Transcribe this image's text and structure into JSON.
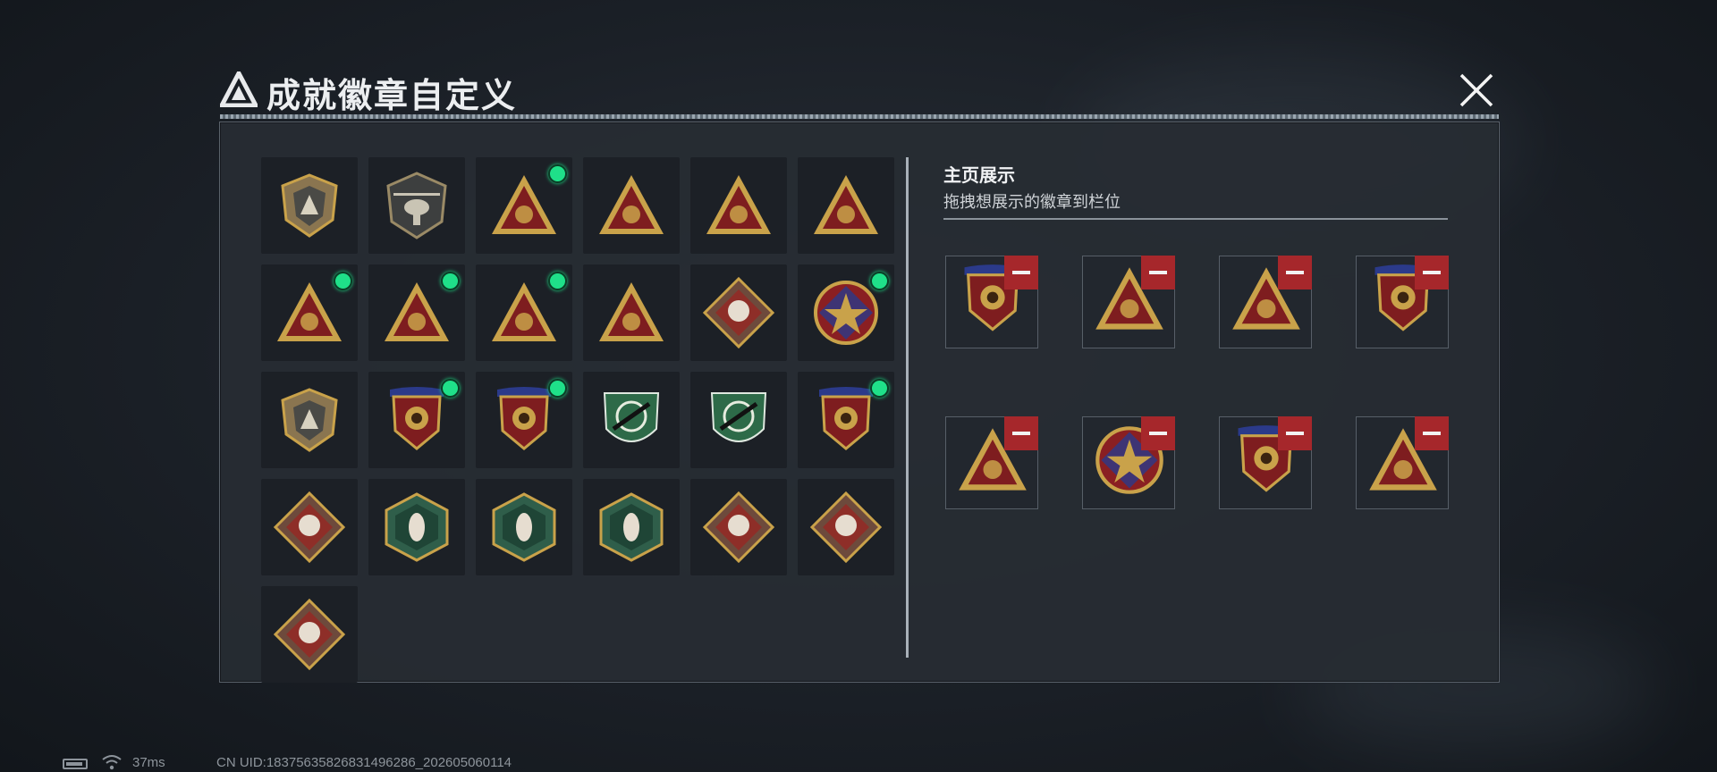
{
  "header": {
    "title": "成就徽章自定义",
    "close_icon": "close-icon"
  },
  "colors": {
    "accent_green": "#1fe089",
    "remove_red": "#a6272b",
    "gold": "#c9a24a",
    "panel": "#272c33"
  },
  "inventory": [
    {
      "id": "gray-shield",
      "type": "shield",
      "new": false
    },
    {
      "id": "helicopter",
      "type": "heli",
      "new": false
    },
    {
      "id": "radar-triangle",
      "type": "tri",
      "new": true
    },
    {
      "id": "s4-triangle",
      "type": "tri",
      "new": false
    },
    {
      "id": "s5-triangle",
      "type": "tri",
      "new": false
    },
    {
      "id": "s5-plane-triangle",
      "type": "tri",
      "new": false
    },
    {
      "id": "rank-1-triangle",
      "type": "tri",
      "new": true
    },
    {
      "id": "gem-triangle",
      "type": "tri",
      "new": true
    },
    {
      "id": "squad-triangle",
      "type": "tri",
      "new": true
    },
    {
      "id": "squad-flag",
      "type": "tri",
      "new": false
    },
    {
      "id": "rose-diamond",
      "type": "diamond",
      "new": false
    },
    {
      "id": "star-medal",
      "type": "round",
      "new": true
    },
    {
      "id": "arrow-shield",
      "type": "shield",
      "new": false
    },
    {
      "id": "gold-emblem-medal",
      "type": "medal",
      "new": true
    },
    {
      "id": "red-gem-medal",
      "type": "medal",
      "new": true
    },
    {
      "id": "green-sniper-shield",
      "type": "greenshield",
      "new": false
    },
    {
      "id": "green-crosshair-shield",
      "type": "greenshield",
      "new": false
    },
    {
      "id": "blue-missile-medal",
      "type": "medal",
      "new": true
    },
    {
      "id": "wolf-diamond",
      "type": "diamond",
      "new": false
    },
    {
      "id": "wasp-hex",
      "type": "hex",
      "new": false
    },
    {
      "id": "wasp-hex-2",
      "type": "hex",
      "new": false
    },
    {
      "id": "fist-hex",
      "type": "hex",
      "new": false
    },
    {
      "id": "dragon-diamond",
      "type": "diamond",
      "new": false
    },
    {
      "id": "dragon-diamond-2",
      "type": "diamond",
      "new": false
    },
    {
      "id": "runner-diamond",
      "type": "diamond",
      "new": false
    }
  ],
  "showcase": {
    "title": "主页展示",
    "subtitle": "拖拽想展示的徽章到栏位",
    "slots": [
      {
        "id": "red-gem-medal",
        "type": "medal"
      },
      {
        "id": "radar-triangle",
        "type": "tri"
      },
      {
        "id": "squad-triangle",
        "type": "tri"
      },
      {
        "id": "blue-missile-medal",
        "type": "medal"
      },
      {
        "id": "rank-1-triangle",
        "type": "tri"
      },
      {
        "id": "star-medal",
        "type": "round"
      },
      {
        "id": "gold-emblem-medal",
        "type": "medal"
      },
      {
        "id": "gem-triangle",
        "type": "tri"
      }
    ]
  },
  "status_bar": {
    "ping": "37ms",
    "uid": "CN UID:1837563582683149628​6_202605060114"
  }
}
